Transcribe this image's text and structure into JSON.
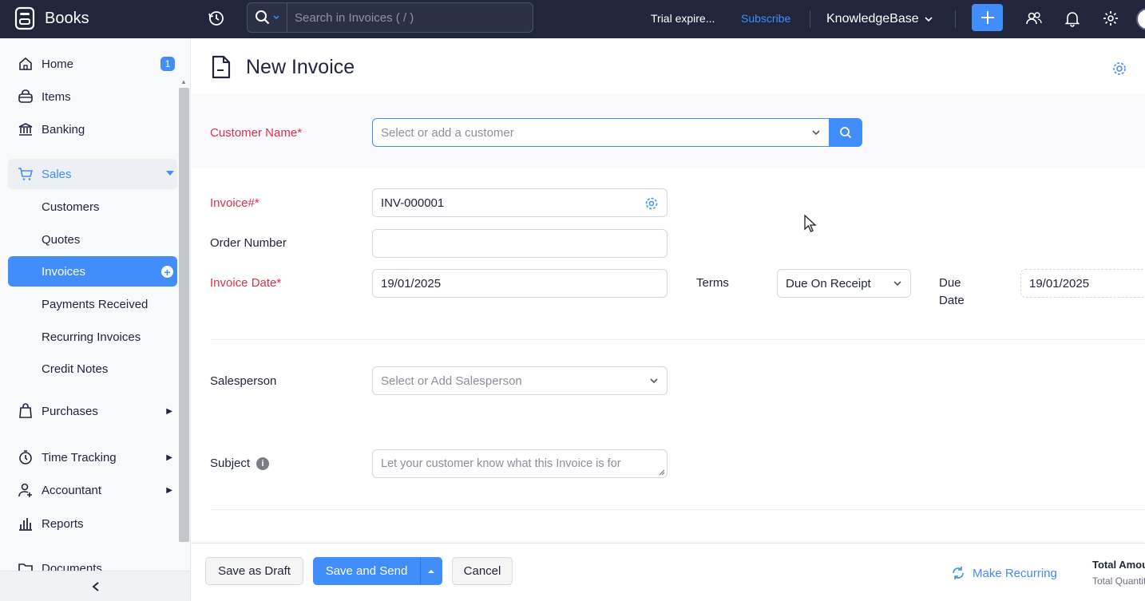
{
  "app": {
    "name": "Books"
  },
  "search": {
    "placeholder": "Search in Invoices ( / )"
  },
  "header": {
    "trial": "Trial expire...",
    "subscribe": "Subscribe",
    "org": "KnowledgeBase"
  },
  "sidebar": {
    "home": "Home",
    "home_badge": "1",
    "items": "Items",
    "banking": "Banking",
    "sales": "Sales",
    "customers": "Customers",
    "quotes": "Quotes",
    "invoices": "Invoices",
    "payments_received": "Payments Received",
    "recurring_invoices": "Recurring Invoices",
    "credit_notes": "Credit Notes",
    "purchases": "Purchases",
    "time_tracking": "Time Tracking",
    "accountant": "Accountant",
    "reports": "Reports",
    "documents": "Documents"
  },
  "page": {
    "title": "New Invoice"
  },
  "form": {
    "customer_label": "Customer Name*",
    "customer_placeholder": "Select or add a customer",
    "invoice_label": "Invoice#*",
    "invoice_value": "INV-000001",
    "order_label": "Order Number",
    "order_value": "",
    "date_label": "Invoice Date*",
    "date_value": "19/01/2025",
    "terms_label": "Terms",
    "terms_value": "Due On Receipt",
    "due_label_1": "Due",
    "due_label_2": "Date",
    "due_value": "19/01/2025",
    "salesperson_label": "Salesperson",
    "salesperson_placeholder": "Select or Add Salesperson",
    "subject_label": "Subject",
    "subject_placeholder": "Let your customer know what this Invoice is for"
  },
  "footer": {
    "save_draft": "Save as Draft",
    "save_send": "Save and Send",
    "cancel": "Cancel",
    "make_recurring": "Make Recurring",
    "total_amount": "Total Amount",
    "total_quantity": "Total Quantity"
  }
}
